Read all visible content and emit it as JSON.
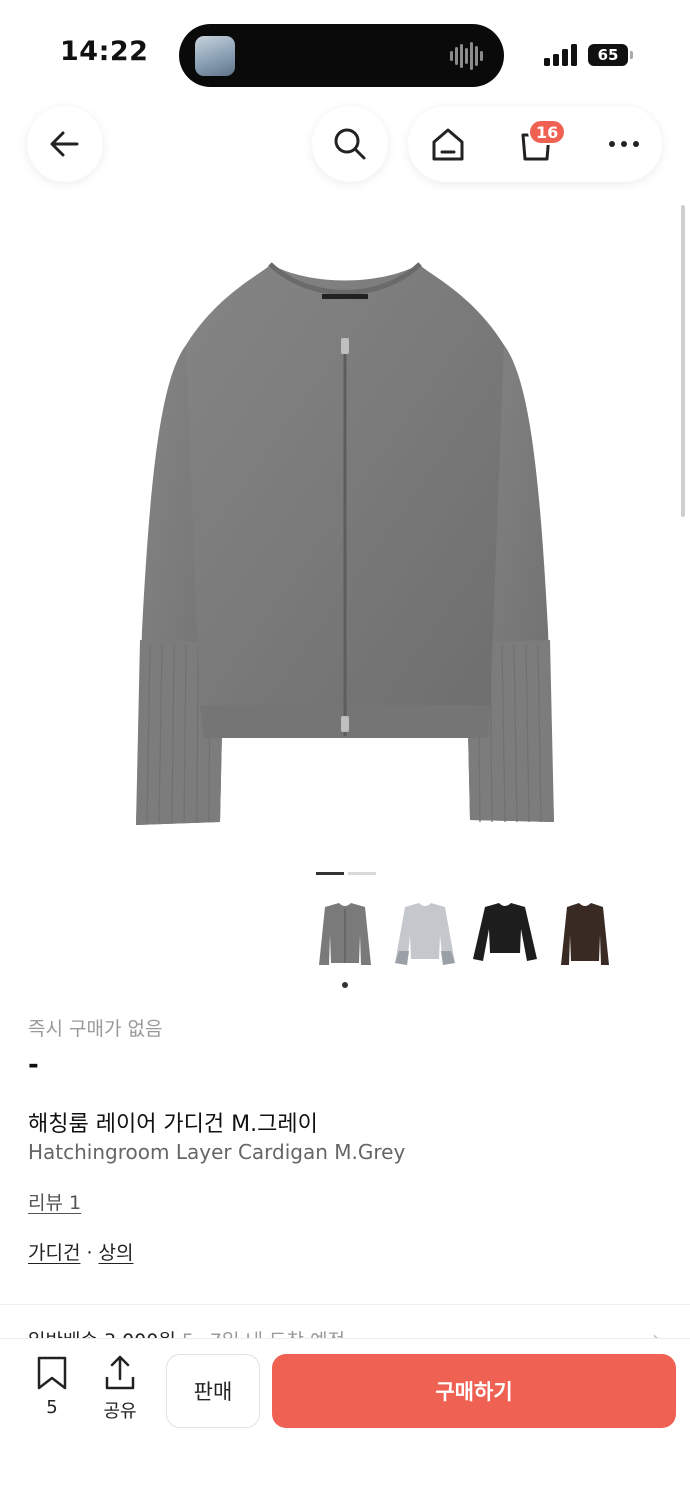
{
  "status_bar": {
    "time": "14:22",
    "battery": "65"
  },
  "header": {
    "cart_count": "16"
  },
  "product": {
    "instant_purchase_text": "즉시 구매가 없음",
    "price": "-",
    "name_ko": "해칭룸 레이어 가디건 M.그레이",
    "name_en": "Hatchingroom Layer Cardigan M.Grey",
    "review_link": "리뷰 1",
    "category_1": "가디건",
    "category_separator": "·",
    "category_2": "상의",
    "color_variants": [
      "grey",
      "light-grey",
      "black",
      "brown"
    ]
  },
  "shipping": {
    "text": "일반배송 3,000원",
    "detail": "5~7일 내 도착 예정"
  },
  "bottom_bar": {
    "bookmark_count": "5",
    "share_label": "공유",
    "sell_label": "판매",
    "buy_label": "구매하기"
  },
  "colors": {
    "accent": "#ef6253",
    "product_grey": "#7a7a7a"
  }
}
